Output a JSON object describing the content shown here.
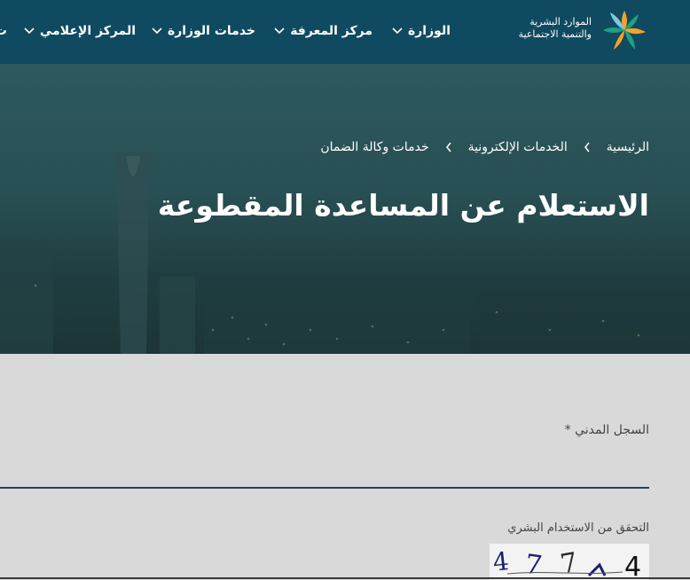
{
  "header": {
    "logo_line1": "الموارد البشرية",
    "logo_line2": "والتنمية الاجتماعية",
    "nav": [
      {
        "label": "الوزارة"
      },
      {
        "label": "مركز المعرفة"
      },
      {
        "label": "خدمات الوزارة"
      },
      {
        "label": "المركز الإعلامي"
      },
      {
        "label": "ت"
      }
    ]
  },
  "hero": {
    "breadcrumb": [
      "الرئيسية",
      "الخدمات الإلكترونية",
      "خدمات وكالة الضمان"
    ],
    "title": "الاستعلام عن المساعدة المقطوعة"
  },
  "form": {
    "civil_label": "السجل المدني *",
    "civil_value": "",
    "captcha_label": "التحقق من الاستخدام البشري",
    "captcha_chars": [
      "4",
      "7",
      "7",
      "4"
    ]
  },
  "colors": {
    "nav_bg": "#0f4a60",
    "page_bg": "#d9d9d9",
    "input_line": "#1d4556"
  }
}
